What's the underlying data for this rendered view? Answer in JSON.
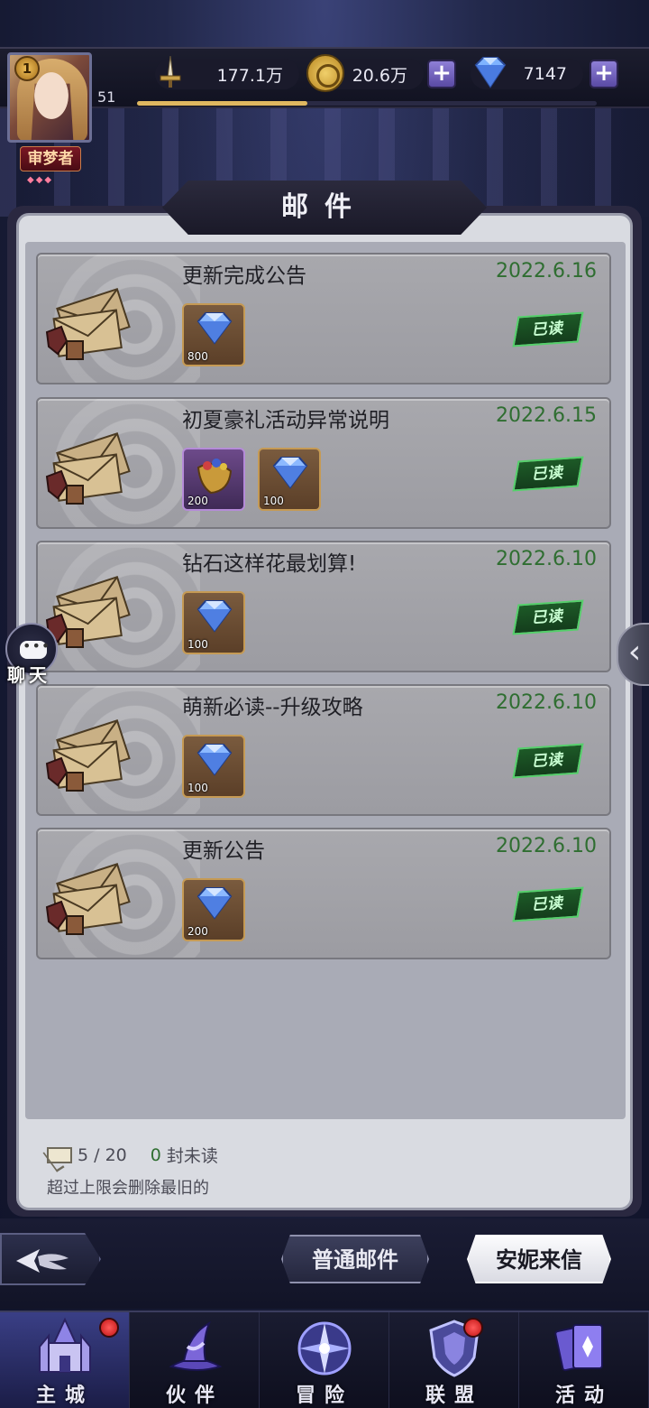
{
  "player": {
    "rank_badge": "1",
    "level": "51",
    "title_tag": "审梦者",
    "xp_fraction": 0.37
  },
  "resources": {
    "power": "177.1万",
    "gold": "20.6万",
    "gems": "7147",
    "plus": "+"
  },
  "panel": {
    "title": "邮件"
  },
  "mails": [
    {
      "subject": "更新完成公告",
      "date": "2022.6.16",
      "status": "已读",
      "rewards": [
        {
          "icon": "diamond-icon",
          "qty": "800",
          "frame": "brown"
        }
      ]
    },
    {
      "subject": "初夏豪礼活动异常说明",
      "date": "2022.6.15",
      "status": "已读",
      "rewards": [
        {
          "icon": "gift-horn-icon",
          "qty": "200",
          "frame": "purple"
        },
        {
          "icon": "diamond-icon",
          "qty": "100",
          "frame": "brown"
        }
      ]
    },
    {
      "subject": "钻石这样花最划算!",
      "date": "2022.6.10",
      "status": "已读",
      "rewards": [
        {
          "icon": "diamond-icon",
          "qty": "100",
          "frame": "brown"
        }
      ]
    },
    {
      "subject": "萌新必读--升级攻略",
      "date": "2022.6.10",
      "status": "已读",
      "rewards": [
        {
          "icon": "diamond-icon",
          "qty": "100",
          "frame": "brown"
        }
      ]
    },
    {
      "subject": "更新公告",
      "date": "2022.6.10",
      "status": "已读",
      "rewards": [
        {
          "icon": "diamond-icon",
          "qty": "200",
          "frame": "brown"
        }
      ]
    }
  ],
  "footer": {
    "count": "5 / 20",
    "unread_num": "0",
    "unread_text": "封未读",
    "note": "超过上限会删除最旧的"
  },
  "chat": {
    "label": "聊天"
  },
  "tabs": {
    "normal": "普通邮件",
    "anny": "安妮来信"
  },
  "nav": [
    {
      "label": "主城",
      "icon": "castle-icon",
      "badge": true
    },
    {
      "label": "伙伴",
      "icon": "witch-hat-icon",
      "badge": false
    },
    {
      "label": "冒险",
      "icon": "compass-icon",
      "badge": false
    },
    {
      "label": "联盟",
      "icon": "shield-icon",
      "badge": true
    },
    {
      "label": "活动",
      "icon": "cards-icon",
      "badge": false
    }
  ],
  "colors": {
    "date_green": "#2f6e31",
    "read_stamp": "#1d5a27",
    "nav_active": "#3a3f86"
  }
}
